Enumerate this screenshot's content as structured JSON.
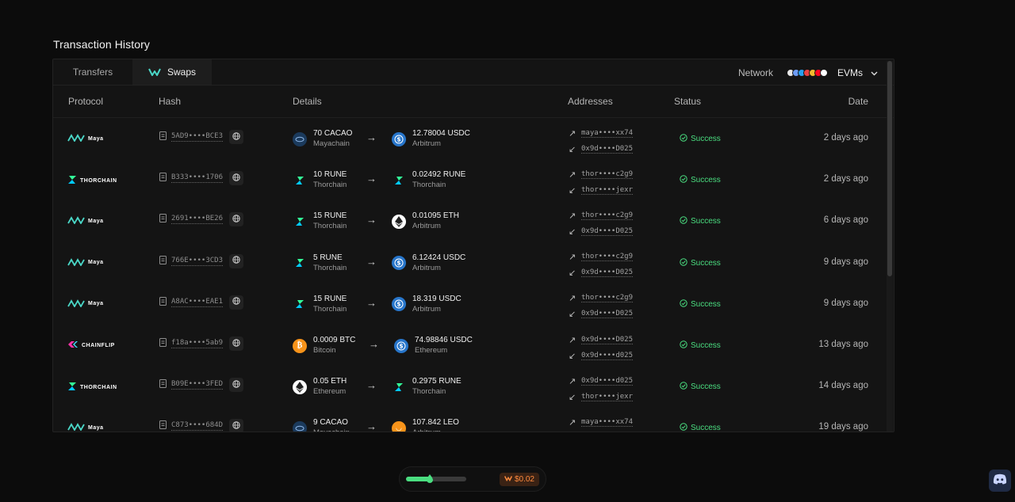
{
  "page": {
    "title": "Transaction History"
  },
  "tabs": [
    {
      "label": "Transfers",
      "active": false
    },
    {
      "label": "Swaps",
      "active": true
    }
  ],
  "network": {
    "label": "Network",
    "selected": "EVMs",
    "chain_icon_colors": [
      "#e8e8e8",
      "#6d9cf6",
      "#28a0f0",
      "#e84142",
      "#f3ba2f",
      "#ff0420",
      "#ffffff"
    ]
  },
  "columns": {
    "protocol": "Protocol",
    "hash": "Hash",
    "details": "Details",
    "addresses": "Addresses",
    "status": "Status",
    "date": "Date"
  },
  "rows": [
    {
      "protocol": "Maya",
      "protocol_icon": "maya-logo-icon",
      "hash": "5AD9••••BCE3",
      "from": {
        "amount": "70 CACAO",
        "chain": "Mayachain",
        "icon": "cacao-coin-icon",
        "color": "#1b3a5c"
      },
      "to": {
        "amount": "12.78004 USDC",
        "chain": "Arbitrum",
        "icon": "usdc-coin-icon",
        "color": "#2775ca"
      },
      "addr_out": "maya••••xx74",
      "addr_in": "0x9d••••D025",
      "status": "Success",
      "date": "2 days ago"
    },
    {
      "protocol": "THORCHAIN",
      "protocol_icon": "thorchain-logo-icon",
      "hash": "B333••••1706",
      "from": {
        "amount": "10 RUNE",
        "chain": "Thorchain",
        "icon": "rune-coin-icon",
        "color": "#141414"
      },
      "to": {
        "amount": "0.02492 RUNE",
        "chain": "Thorchain",
        "icon": "rune-coin-icon",
        "color": "#141414"
      },
      "addr_out": "thor••••c2g9",
      "addr_in": "thor••••jexr",
      "status": "Success",
      "date": "2 days ago"
    },
    {
      "protocol": "Maya",
      "protocol_icon": "maya-logo-icon",
      "hash": "2691••••BE26",
      "from": {
        "amount": "15 RUNE",
        "chain": "Thorchain",
        "icon": "rune-coin-icon",
        "color": "#141414"
      },
      "to": {
        "amount": "0.01095 ETH",
        "chain": "Arbitrum",
        "icon": "eth-coin-icon",
        "color": "#ffffff"
      },
      "addr_out": "thor••••c2g9",
      "addr_in": "0x9d••••D025",
      "status": "Success",
      "date": "6 days ago"
    },
    {
      "protocol": "Maya",
      "protocol_icon": "maya-logo-icon",
      "hash": "766E••••3CD3",
      "from": {
        "amount": "5 RUNE",
        "chain": "Thorchain",
        "icon": "rune-coin-icon",
        "color": "#141414"
      },
      "to": {
        "amount": "6.12424 USDC",
        "chain": "Arbitrum",
        "icon": "usdc-coin-icon",
        "color": "#2775ca"
      },
      "addr_out": "thor••••c2g9",
      "addr_in": "0x9d••••D025",
      "status": "Success",
      "date": "9 days ago"
    },
    {
      "protocol": "Maya",
      "protocol_icon": "maya-logo-icon",
      "hash": "A8AC••••EAE1",
      "from": {
        "amount": "15 RUNE",
        "chain": "Thorchain",
        "icon": "rune-coin-icon",
        "color": "#141414"
      },
      "to": {
        "amount": "18.319 USDC",
        "chain": "Arbitrum",
        "icon": "usdc-coin-icon",
        "color": "#2775ca"
      },
      "addr_out": "thor••••c2g9",
      "addr_in": "0x9d••••D025",
      "status": "Success",
      "date": "9 days ago"
    },
    {
      "protocol": "CHAINFLIP",
      "protocol_icon": "chainflip-logo-icon",
      "hash": "f18a••••5ab9",
      "from": {
        "amount": "0.0009 BTC",
        "chain": "Bitcoin",
        "icon": "btc-coin-icon",
        "color": "#f7931a"
      },
      "to": {
        "amount": "74.98846 USDC",
        "chain": "Ethereum",
        "icon": "usdc-coin-icon",
        "color": "#2775ca"
      },
      "addr_out": "0x9d••••D025",
      "addr_in": "0x9d••••d025",
      "status": "Success",
      "date": "13 days ago"
    },
    {
      "protocol": "THORCHAIN",
      "protocol_icon": "thorchain-logo-icon",
      "hash": "B09E••••3FED",
      "from": {
        "amount": "0.05 ETH",
        "chain": "Ethereum",
        "icon": "eth-coin-icon",
        "color": "#ffffff"
      },
      "to": {
        "amount": "0.2975 RUNE",
        "chain": "Thorchain",
        "icon": "rune-coin-icon",
        "color": "#141414"
      },
      "addr_out": "0x9d••••d025",
      "addr_in": "thor••••jexr",
      "status": "Success",
      "date": "14 days ago"
    },
    {
      "protocol": "Maya",
      "protocol_icon": "maya-logo-icon",
      "hash": "C873••••684D",
      "from": {
        "amount": "9 CACAO",
        "chain": "Mayachain",
        "icon": "cacao-coin-icon",
        "color": "#1b3a5c"
      },
      "to": {
        "amount": "107.842 LEO",
        "chain": "Arbitrum",
        "icon": "leo-coin-icon",
        "color": "#f7931a"
      },
      "addr_out": "maya••••xx74",
      "addr_in": "",
      "status": "Success",
      "date": "19 days ago"
    }
  ],
  "gas": {
    "level": 0.4,
    "fee": "$0.02"
  },
  "colors": {
    "success": "#4ade80",
    "accent": "#4ad7c7",
    "fee": "#ff8a3d"
  }
}
